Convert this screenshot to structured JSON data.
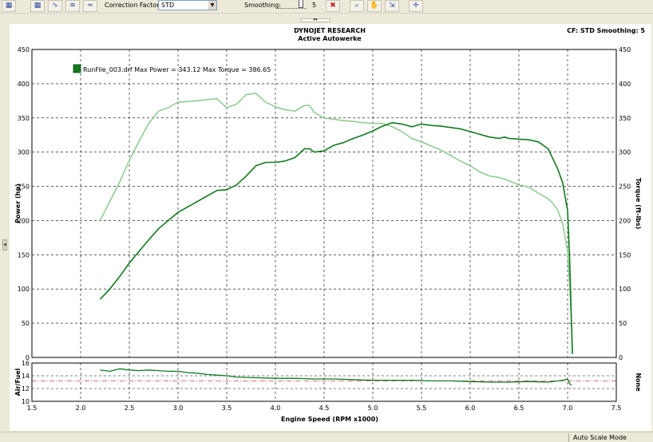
{
  "toolbar": {
    "correction_label": "Correction Factor:",
    "correction_value": "STD",
    "smoothing_label": "Smoothing:",
    "smoothing_value": "5"
  },
  "statusbar": {
    "mode_text": "Auto Scale Mode"
  },
  "colors": {
    "power": "#0f7a1e",
    "torque": "#8cc98c",
    "afr_target": "#c84060",
    "grid": "#000000"
  },
  "chart_data": {
    "type": "line",
    "header_title": "DYNOJET RESEARCH",
    "header_subtitle": "Active Autowerke",
    "header_right": "CF: STD  Smoothing: 5",
    "legend": "RunFile_003.drf Max Power = 343.12 Max Torque = 386.65",
    "xlabel": "Engine Speed (RPM x1000)",
    "ylabel_left": "Power (hp)",
    "ylabel_right": "Torque (ft-lbs)",
    "afr_label": "Air/Fuel",
    "afr_right_label": "None",
    "xlim": [
      1.5,
      7.5
    ],
    "ylim": [
      0,
      450
    ],
    "afr_ylim": [
      10,
      16
    ],
    "x_ticks": [
      "1.5",
      "2.0",
      "2.5",
      "3.0",
      "3.5",
      "4.0",
      "4.5",
      "5.0",
      "5.5",
      "6.0",
      "6.5",
      "7.0",
      "7.5"
    ],
    "y_ticks": [
      "0",
      "50",
      "100",
      "150",
      "200",
      "250",
      "300",
      "350",
      "400",
      "450"
    ],
    "afr_ticks": [
      "10",
      "12",
      "14",
      "16"
    ],
    "afr_target": 13.2,
    "grid": true,
    "series": [
      {
        "key": "power",
        "x": [
          2.2,
          2.3,
          2.4,
          2.5,
          2.6,
          2.7,
          2.8,
          2.9,
          3.0,
          3.1,
          3.2,
          3.3,
          3.4,
          3.5,
          3.6,
          3.7,
          3.8,
          3.9,
          4.0,
          4.1,
          4.2,
          4.3,
          4.35,
          4.4,
          4.5,
          4.6,
          4.7,
          4.8,
          4.9,
          5.0,
          5.1,
          5.2,
          5.3,
          5.4,
          5.5,
          5.6,
          5.7,
          5.8,
          5.9,
          6.0,
          6.1,
          6.2,
          6.3,
          6.35,
          6.4,
          6.5,
          6.6,
          6.7,
          6.8,
          6.85,
          6.9,
          6.95,
          7.0,
          7.02,
          7.04,
          7.05
        ],
        "y": [
          85,
          100,
          118,
          138,
          155,
          172,
          188,
          200,
          212,
          220,
          228,
          236,
          244,
          245,
          252,
          265,
          280,
          285,
          285,
          287,
          292,
          305,
          305,
          300,
          302,
          310,
          314,
          320,
          325,
          331,
          338,
          343,
          341,
          337,
          341,
          339,
          338,
          336,
          334,
          330,
          326,
          322,
          320,
          322,
          320,
          319,
          318,
          315,
          305,
          290,
          275,
          255,
          215,
          150,
          50,
          5
        ]
      },
      {
        "key": "torque",
        "x": [
          2.2,
          2.3,
          2.4,
          2.5,
          2.6,
          2.7,
          2.8,
          2.9,
          3.0,
          3.1,
          3.2,
          3.3,
          3.4,
          3.5,
          3.6,
          3.7,
          3.8,
          3.9,
          4.0,
          4.1,
          4.2,
          4.3,
          4.35,
          4.4,
          4.5,
          4.6,
          4.7,
          4.8,
          4.9,
          5.0,
          5.1,
          5.2,
          5.3,
          5.4,
          5.5,
          5.6,
          5.7,
          5.8,
          5.9,
          6.0,
          6.1,
          6.2,
          6.3,
          6.4,
          6.5,
          6.6,
          6.7,
          6.8,
          6.85,
          6.9,
          6.95,
          7.0,
          7.02,
          7.04,
          7.05
        ],
        "y": [
          200,
          228,
          256,
          288,
          316,
          342,
          360,
          365,
          373,
          374,
          375,
          377,
          378,
          365,
          370,
          384,
          386,
          373,
          366,
          362,
          360,
          368,
          368,
          358,
          350,
          348,
          346,
          345,
          343,
          342,
          342,
          337,
          330,
          320,
          315,
          309,
          303,
          295,
          287,
          280,
          271,
          265,
          263,
          258,
          252,
          249,
          240,
          232,
          225,
          215,
          195,
          155,
          110,
          50,
          10
        ]
      },
      {
        "key": "afr",
        "x": [
          2.2,
          2.3,
          2.4,
          2.5,
          2.6,
          2.7,
          2.8,
          2.9,
          3.0,
          3.1,
          3.2,
          3.3,
          3.4,
          3.5,
          3.6,
          3.8,
          4.0,
          4.2,
          4.4,
          4.6,
          4.8,
          5.0,
          5.2,
          5.4,
          5.6,
          5.8,
          6.0,
          6.2,
          6.4,
          6.6,
          6.8,
          6.9,
          6.95,
          7.0,
          7.02,
          7.04
        ],
        "y": [
          14.9,
          14.7,
          15.1,
          14.9,
          14.8,
          14.9,
          14.8,
          14.7,
          14.7,
          14.5,
          14.4,
          14.2,
          14.1,
          14.0,
          13.8,
          13.7,
          13.6,
          13.6,
          13.5,
          13.5,
          13.4,
          13.3,
          13.3,
          13.3,
          13.2,
          13.2,
          13.1,
          13.0,
          13.0,
          13.1,
          13.0,
          13.2,
          13.3,
          13.5,
          12.8,
          12.5
        ]
      }
    ]
  }
}
